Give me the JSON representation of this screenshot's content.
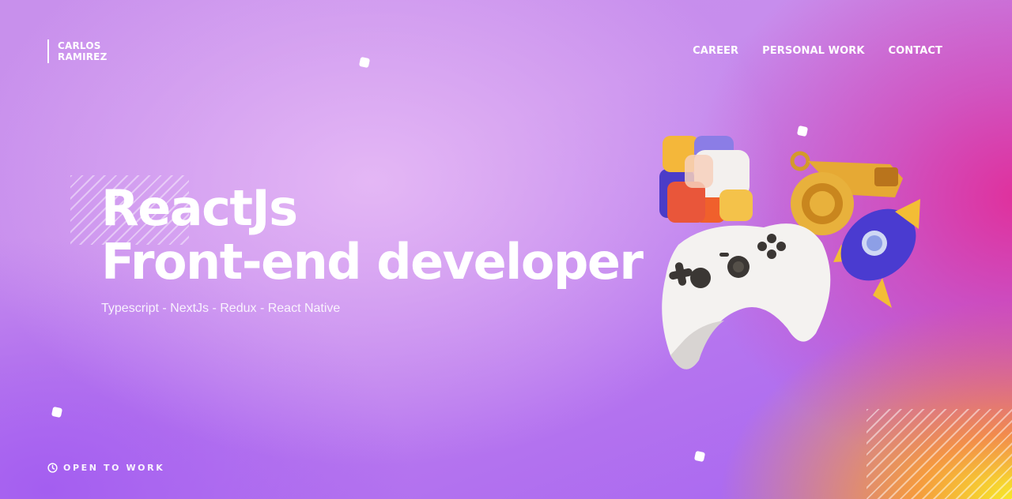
{
  "brand": {
    "first_name": "CARLOS",
    "last_name": "RAMIREZ"
  },
  "nav": {
    "items": [
      {
        "label": "CAREER"
      },
      {
        "label": "PERSONAL WORK"
      },
      {
        "label": "CONTACT"
      }
    ]
  },
  "hero": {
    "title_line1": "ReactJs",
    "title_line2": "Front-end developer",
    "subtitle": "Typescript - NextJs - Redux - React Native"
  },
  "status": {
    "icon": "clock-icon",
    "label": "OPEN TO WORK"
  },
  "illustration": {
    "objects": [
      "cube-icon",
      "whistle-icon",
      "rocket-icon",
      "gamepad-icon"
    ]
  },
  "colors": {
    "text": "#ffffff",
    "purple": "#a664f0",
    "lavender": "#e4b7f5",
    "magenta": "#e0309c",
    "yellow": "#f7f028"
  }
}
